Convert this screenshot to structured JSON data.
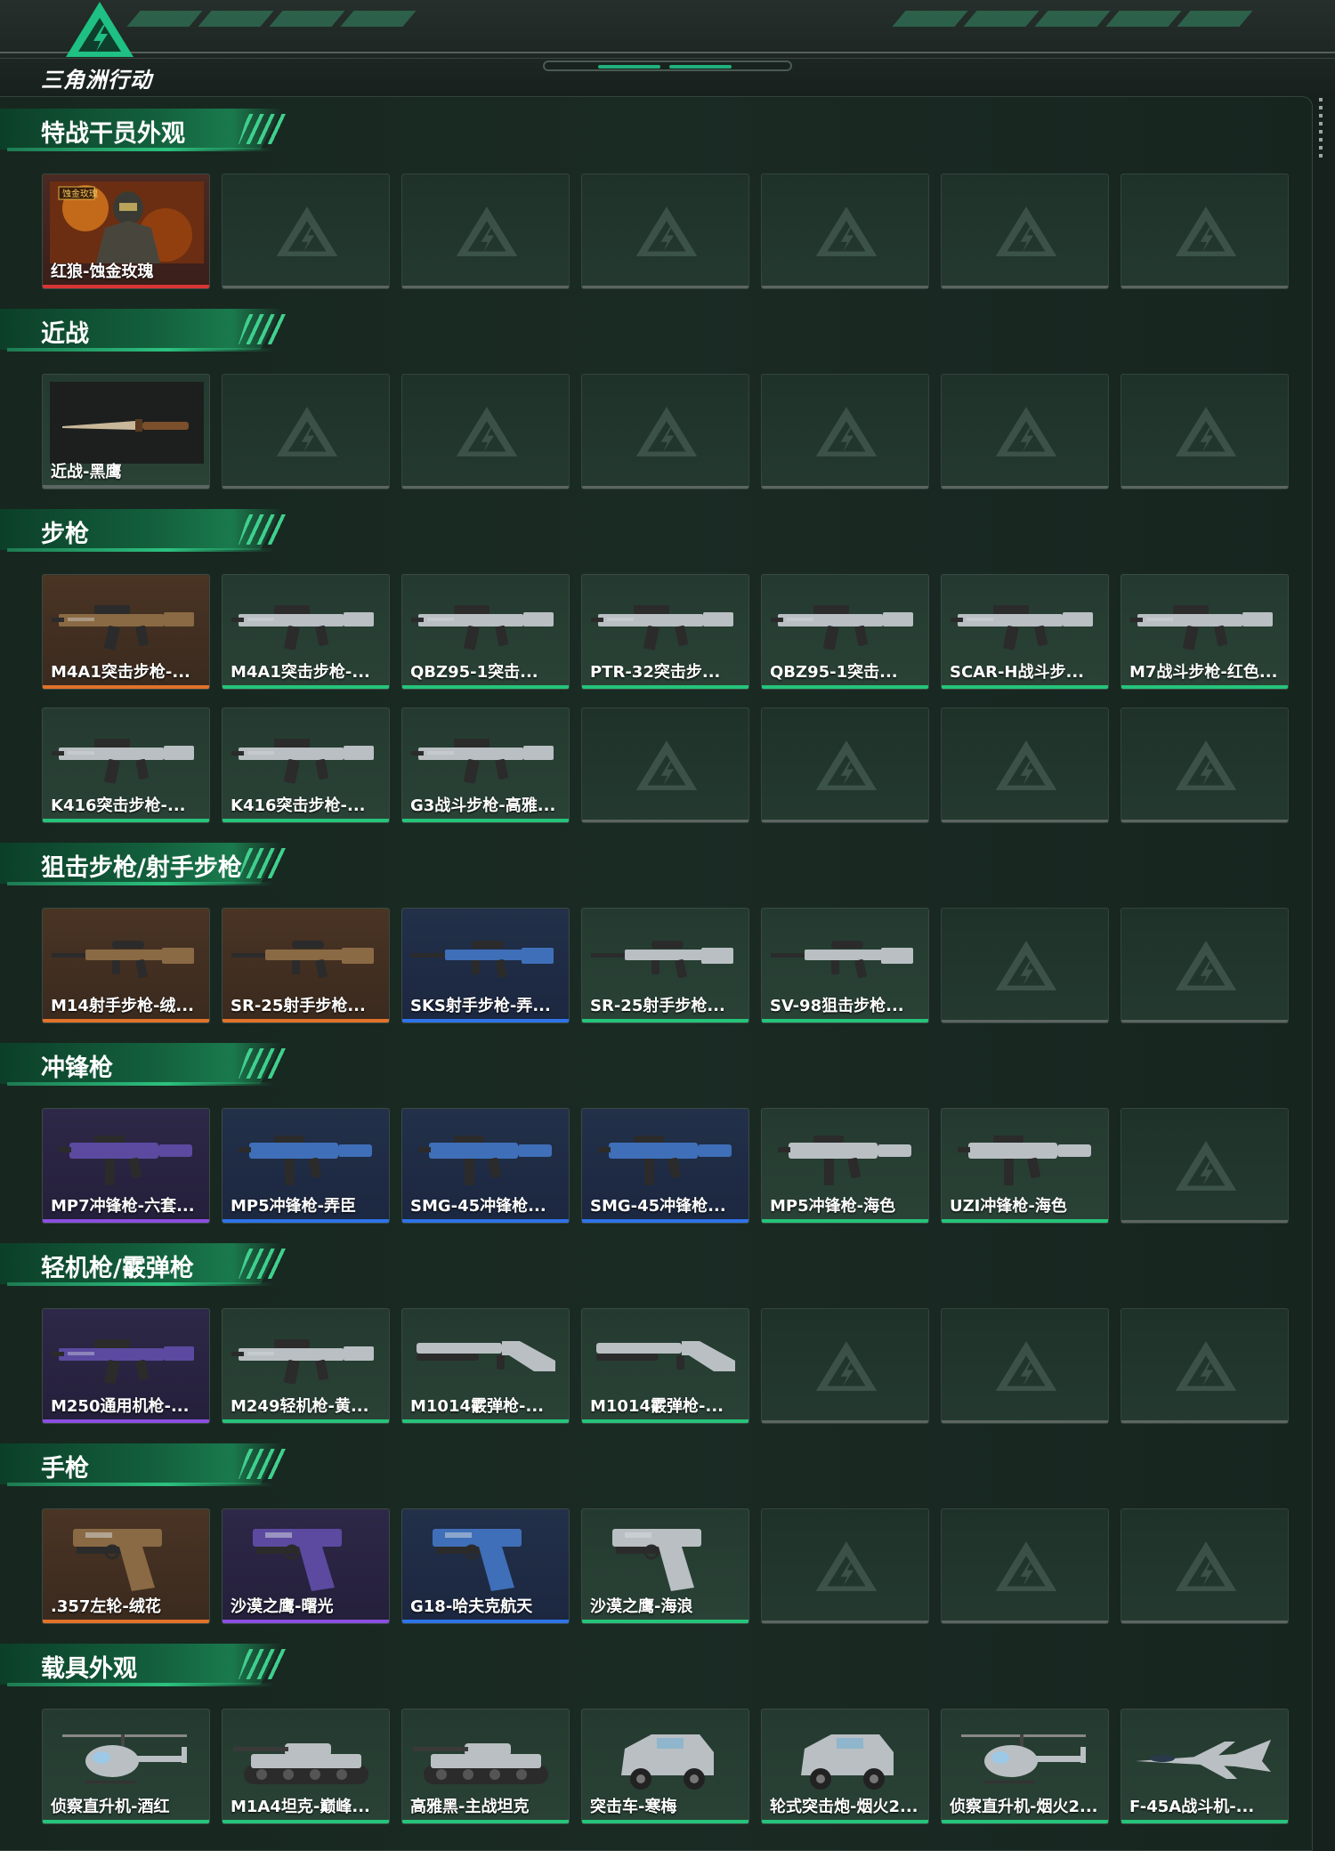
{
  "app": {
    "logo_text": "三角洲行动"
  },
  "colors": {
    "orange": "#e0722a",
    "purple": "#8a4fe0",
    "blue": "#2e74e8",
    "green": "#25c47a",
    "red": "#d93535",
    "gray": "#5b6561"
  },
  "sections": [
    {
      "title": "特战干员外观",
      "items": [
        {
          "label": "红狼-蚀金玫瑰",
          "rarity": "red",
          "icon": "operator-portrait-icon"
        }
      ]
    },
    {
      "title": "近战",
      "items": [
        {
          "label": "近战-黑鹰",
          "rarity": "gray",
          "icon": "knife-icon"
        }
      ]
    },
    {
      "title": "步枪",
      "items": [
        {
          "label": "M4A1突击步枪-...",
          "rarity": "orange",
          "icon": "rifle-icon"
        },
        {
          "label": "M4A1突击步枪-...",
          "rarity": "green",
          "icon": "rifle-icon"
        },
        {
          "label": "QBZ95-1突击...",
          "rarity": "green",
          "icon": "rifle-icon"
        },
        {
          "label": "PTR-32突击步...",
          "rarity": "green",
          "icon": "rifle-icon"
        },
        {
          "label": "QBZ95-1突击...",
          "rarity": "green",
          "icon": "rifle-icon"
        },
        {
          "label": "SCAR-H战斗步...",
          "rarity": "green",
          "icon": "rifle-icon"
        },
        {
          "label": "M7战斗步枪-红色...",
          "rarity": "green",
          "icon": "rifle-icon"
        },
        {
          "label": "K416突击步枪-...",
          "rarity": "green",
          "icon": "rifle-icon"
        },
        {
          "label": "K416突击步枪-...",
          "rarity": "green",
          "icon": "rifle-icon"
        },
        {
          "label": "G3战斗步枪-高雅...",
          "rarity": "green",
          "icon": "rifle-icon"
        }
      ]
    },
    {
      "title": "狙击步枪/射手步枪",
      "items": [
        {
          "label": "M14射手步枪-绒...",
          "rarity": "orange",
          "icon": "sniper-icon"
        },
        {
          "label": "SR-25射手步枪...",
          "rarity": "orange",
          "icon": "sniper-icon"
        },
        {
          "label": "SKS射手步枪-弄...",
          "rarity": "blue",
          "icon": "sniper-icon"
        },
        {
          "label": "SR-25射手步枪...",
          "rarity": "green",
          "icon": "sniper-icon"
        },
        {
          "label": "SV-98狙击步枪...",
          "rarity": "green",
          "icon": "sniper-icon"
        }
      ]
    },
    {
      "title": "冲锋枪",
      "items": [
        {
          "label": "MP7冲锋枪-六套...",
          "rarity": "purple",
          "icon": "smg-icon"
        },
        {
          "label": "MP5冲锋枪-弄臣",
          "rarity": "blue",
          "icon": "smg-icon"
        },
        {
          "label": "SMG-45冲锋枪...",
          "rarity": "blue",
          "icon": "smg-icon"
        },
        {
          "label": "SMG-45冲锋枪...",
          "rarity": "blue",
          "icon": "smg-icon"
        },
        {
          "label": "MP5冲锋枪-海色",
          "rarity": "green",
          "icon": "smg-icon"
        },
        {
          "label": "UZI冲锋枪-海色",
          "rarity": "green",
          "icon": "smg-icon"
        }
      ]
    },
    {
      "title": "轻机枪/霰弹枪",
      "items": [
        {
          "label": "M250通用机枪-...",
          "rarity": "purple",
          "icon": "lmg-icon"
        },
        {
          "label": "M249轻机枪-黄...",
          "rarity": "green",
          "icon": "lmg-icon"
        },
        {
          "label": "M1014霰弹枪-...",
          "rarity": "green",
          "icon": "shotgun-icon"
        },
        {
          "label": "M1014霰弹枪-...",
          "rarity": "green",
          "icon": "shotgun-icon"
        }
      ]
    },
    {
      "title": "手枪",
      "items": [
        {
          "label": ".357左轮-绒花",
          "rarity": "orange",
          "icon": "revolver-icon"
        },
        {
          "label": "沙漠之鹰-曙光",
          "rarity": "purple",
          "icon": "pistol-icon"
        },
        {
          "label": "G18-哈夫克航天",
          "rarity": "blue",
          "icon": "pistol-icon"
        },
        {
          "label": "沙漠之鹰-海浪",
          "rarity": "green",
          "icon": "pistol-icon"
        }
      ]
    },
    {
      "title": "载具外观",
      "items": [
        {
          "label": "侦察直升机-酒红",
          "rarity": "green",
          "icon": "helicopter-icon"
        },
        {
          "label": "M1A4坦克-巅峰...",
          "rarity": "green",
          "icon": "tank-icon"
        },
        {
          "label": "高雅黑-主战坦克",
          "rarity": "green",
          "icon": "tank-icon"
        },
        {
          "label": "突击车-寒梅",
          "rarity": "green",
          "icon": "assault-vehicle-icon"
        },
        {
          "label": "轮式突击炮-烟火2...",
          "rarity": "green",
          "icon": "armored-car-icon"
        },
        {
          "label": "侦察直升机-烟火2...",
          "rarity": "green",
          "icon": "helicopter-icon"
        },
        {
          "label": "F-45A战斗机-...",
          "rarity": "green",
          "icon": "jet-icon"
        }
      ]
    }
  ]
}
